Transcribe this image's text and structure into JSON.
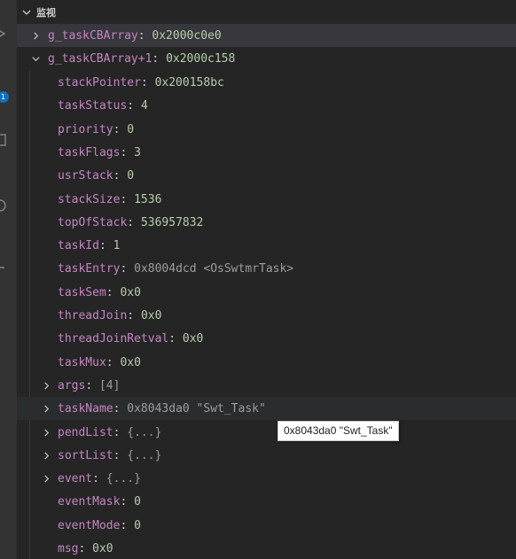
{
  "section": {
    "title": "监视"
  },
  "watches": [
    {
      "name": "g_taskCBArray",
      "value": "0x2000c0e0",
      "expanded": false
    },
    {
      "name": "g_taskCBArray+1",
      "value": "0x2000c158",
      "expanded": true
    }
  ],
  "fields": [
    {
      "name": "stackPointer",
      "value": "0x200158bc",
      "kind": "num"
    },
    {
      "name": "taskStatus",
      "value": "4",
      "kind": "num"
    },
    {
      "name": "priority",
      "value": "0",
      "kind": "num"
    },
    {
      "name": "taskFlags",
      "value": "3",
      "kind": "num"
    },
    {
      "name": "usrStack",
      "value": "0",
      "kind": "num"
    },
    {
      "name": "stackSize",
      "value": "1536",
      "kind": "num"
    },
    {
      "name": "topOfStack",
      "value": "536957832",
      "kind": "num"
    },
    {
      "name": "taskId",
      "value": "1",
      "kind": "num"
    },
    {
      "name": "taskEntry",
      "value": "0x8004dcd <OsSwtmrTask>",
      "kind": "dim"
    },
    {
      "name": "taskSem",
      "value": "0x0",
      "kind": "num"
    },
    {
      "name": "threadJoin",
      "value": "0x0",
      "kind": "num"
    },
    {
      "name": "threadJoinRetval",
      "value": "0x0",
      "kind": "num"
    },
    {
      "name": "taskMux",
      "value": "0x0",
      "kind": "num"
    },
    {
      "name": "args",
      "value": "[4]",
      "kind": "dim",
      "expandable": true
    },
    {
      "name": "taskName",
      "value": "0x8043da0 \"Swt_Task\"",
      "kind": "dim",
      "expandable": true,
      "hovered": true
    },
    {
      "name": "pendList",
      "value": "{...}",
      "kind": "dim",
      "expandable": true
    },
    {
      "name": "sortList",
      "value": "{...}",
      "kind": "dim",
      "expandable": true
    },
    {
      "name": "event",
      "value": "{...}",
      "kind": "dim",
      "expandable": true
    },
    {
      "name": "eventMask",
      "value": "0",
      "kind": "num"
    },
    {
      "name": "eventMode",
      "value": "0",
      "kind": "num"
    },
    {
      "name": "msg",
      "value": "0x0",
      "kind": "num"
    }
  ],
  "tooltip": {
    "text": "0x8043da0 \"Swt_Task\""
  },
  "activity_badge": "1",
  "colors": {
    "background": "#252526",
    "variable_name": "#c586c0",
    "number_value": "#b5cea8",
    "dim_value": "#9d9d9d",
    "hover_row": "#2a2d2e"
  }
}
